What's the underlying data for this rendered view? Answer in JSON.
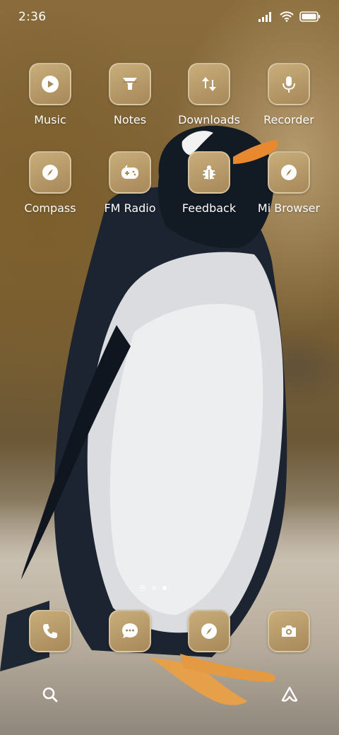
{
  "status_bar": {
    "time": "2:36",
    "icons": [
      "signal-icon",
      "wifi-icon",
      "battery-icon"
    ]
  },
  "apps_row1": [
    {
      "label": "Music",
      "icon": "play-icon"
    },
    {
      "label": "Notes",
      "icon": "notes-icon"
    },
    {
      "label": "Downloads",
      "icon": "downloads-icon"
    },
    {
      "label": "Recorder",
      "icon": "microphone-icon"
    }
  ],
  "apps_row2": [
    {
      "label": "Compass",
      "icon": "compass-icon"
    },
    {
      "label": "FM Radio",
      "icon": "gamepad-icon"
    },
    {
      "label": "Feedback",
      "icon": "bug-icon"
    },
    {
      "label": "Mi Browser",
      "icon": "compass-icon"
    }
  ],
  "dock": [
    {
      "name": "phone",
      "icon": "phone-icon"
    },
    {
      "name": "messages",
      "icon": "chat-icon"
    },
    {
      "name": "browser",
      "icon": "compass-icon"
    },
    {
      "name": "camera",
      "icon": "camera-icon"
    }
  ],
  "page_indicator": {
    "pages": 2,
    "active": 2
  },
  "bottom_icons": [
    "search-icon",
    "app-vault-icon"
  ],
  "colors": {
    "tile": "#b7996a",
    "tile_border": "#ece2c8"
  }
}
